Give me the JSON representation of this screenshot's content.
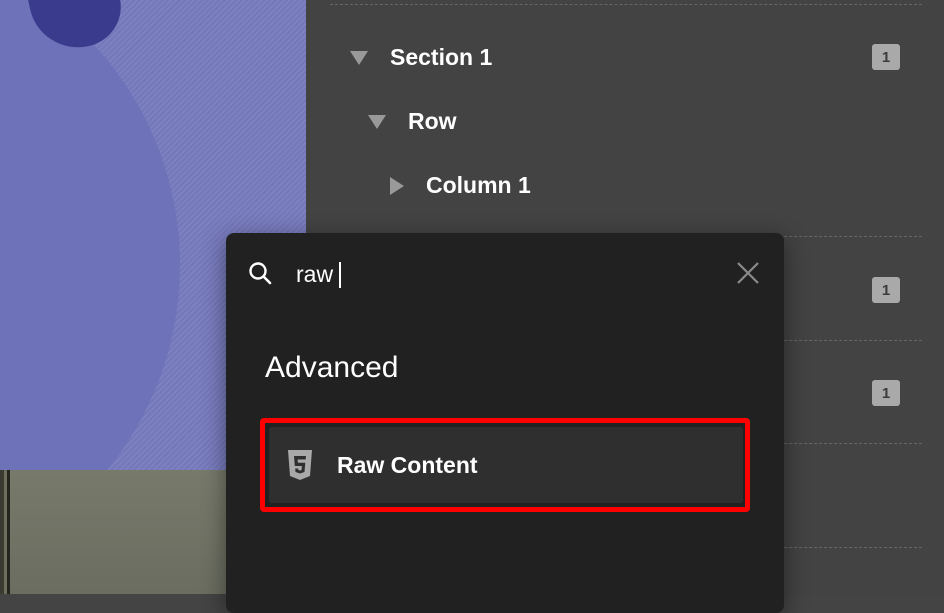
{
  "navigator": {
    "items": [
      {
        "label": "Section 1",
        "expanded": true
      },
      {
        "label": "Row",
        "expanded": true
      },
      {
        "label": "Column 1",
        "expanded": false
      }
    ],
    "badges": [
      "1",
      "1",
      "1"
    ]
  },
  "search": {
    "value": "raw",
    "placeholder": ""
  },
  "results": {
    "group_heading": "Advanced",
    "items": [
      {
        "label": "Raw Content",
        "icon": "html5-icon"
      }
    ]
  },
  "colors": {
    "highlight": "#ff0000",
    "popup_bg": "#212121",
    "panel_bg": "#434343",
    "canvas_bg": "#7c7fc2"
  }
}
